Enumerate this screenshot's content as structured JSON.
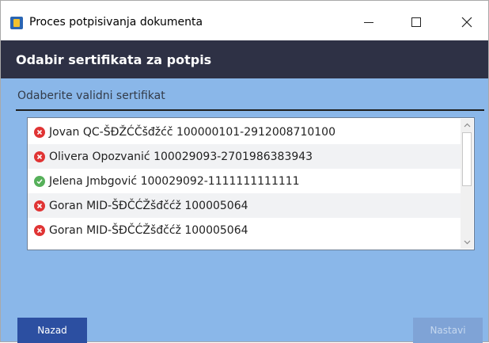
{
  "window": {
    "title": "Proces potpisivanja dokumenta",
    "minimize_icon": "minimize-icon",
    "maximize_icon": "maximize-icon",
    "close_icon": "close-icon"
  },
  "header": {
    "title": "Odabir sertifikata za potpis"
  },
  "section": {
    "label": "Odaberite validni sertifikat"
  },
  "certificates": [
    {
      "label": "Jovan QC-ŠĐŽĆČšđžćč 100000101-2912008710100",
      "status": "invalid"
    },
    {
      "label": "Olivera Opozvanić 100029093-2701986383943",
      "status": "invalid"
    },
    {
      "label": "Jelena Jmbgović 100029092-1111111111111",
      "status": "valid"
    },
    {
      "label": "Goran MID-ŠĐČĆŽšđčćž 100005064",
      "status": "invalid"
    },
    {
      "label": "Goran MID-ŠĐČĆŽšđčćž 100005064",
      "status": "invalid"
    }
  ],
  "buttons": {
    "back": "Nazad",
    "next": "Nastavi",
    "next_enabled": false
  },
  "colors": {
    "body_background": "#8ab7e9",
    "header_background": "#2e3145",
    "back_button": "#2c4fa1",
    "next_button_disabled": "#7fa3d6",
    "invalid_status": "#e03434",
    "valid_status": "#56b05a"
  }
}
